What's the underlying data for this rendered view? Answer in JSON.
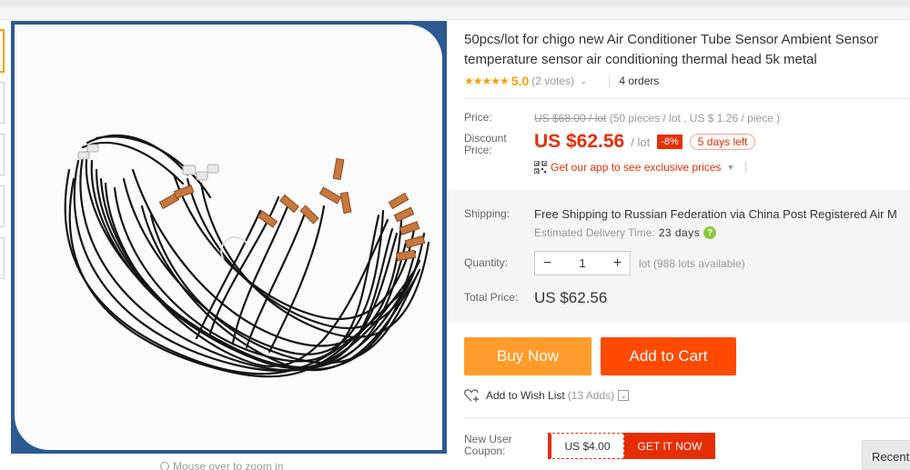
{
  "product": {
    "title_line1": "50pcs/lot for chigo new Air Conditioner Tube Sensor Ambient Sensor",
    "title_line2": "temperature sensor air conditioning thermal head 5k metal",
    "rating": {
      "stars": "★★★★★",
      "value": "5.0",
      "votes": "(2 votes)",
      "chevron": "⌄",
      "orders": "4 orders",
      "star_color": "#f4a100"
    }
  },
  "pricing": {
    "price_label": "Price:",
    "old_price": "US $68.00 / lot",
    "old_price_detail": "(50 pieces / lot , US $ 1.26 / piece )",
    "discount_label_line1": "Discount",
    "discount_label_line2": "Price:",
    "current_price": "US $62.56",
    "unit": "/ lot",
    "discount_badge": "-8%",
    "time_left": "5 days left",
    "app_promo": "Get our app to see exclusive prices",
    "accent_color": "#e62e04"
  },
  "shipping": {
    "label": "Shipping:",
    "free": "Free Shipping",
    "destination": " to Russian Federation via China Post Registered Air M",
    "eta_label": "Estimated Delivery Time:",
    "eta_value": "23 days",
    "help_icon": "?"
  },
  "quantity": {
    "label": "Quantity:",
    "minus": "−",
    "value": "1",
    "plus": "+",
    "available": "lot (988 lots available)"
  },
  "total": {
    "label": "Total Price:",
    "value": "US $62.56"
  },
  "actions": {
    "buy_now": "Buy Now",
    "add_to_cart": "Add to Cart",
    "wish_list": "Add to Wish List",
    "wish_count": "(13 Adds)",
    "wish_dropdown": "⌄",
    "buy_color": "#ff9c2b",
    "cart_color": "#ff4a00"
  },
  "coupon": {
    "label_line1": "New User",
    "label_line2": "Coupon:",
    "amount": "US $4.00",
    "button": "GET IT NOW"
  },
  "gallery": {
    "zoom_hint": "Mouse over to zoom in",
    "frame_color": "#2d5a92"
  },
  "sidebar_tab": {
    "recent": "Recent"
  }
}
